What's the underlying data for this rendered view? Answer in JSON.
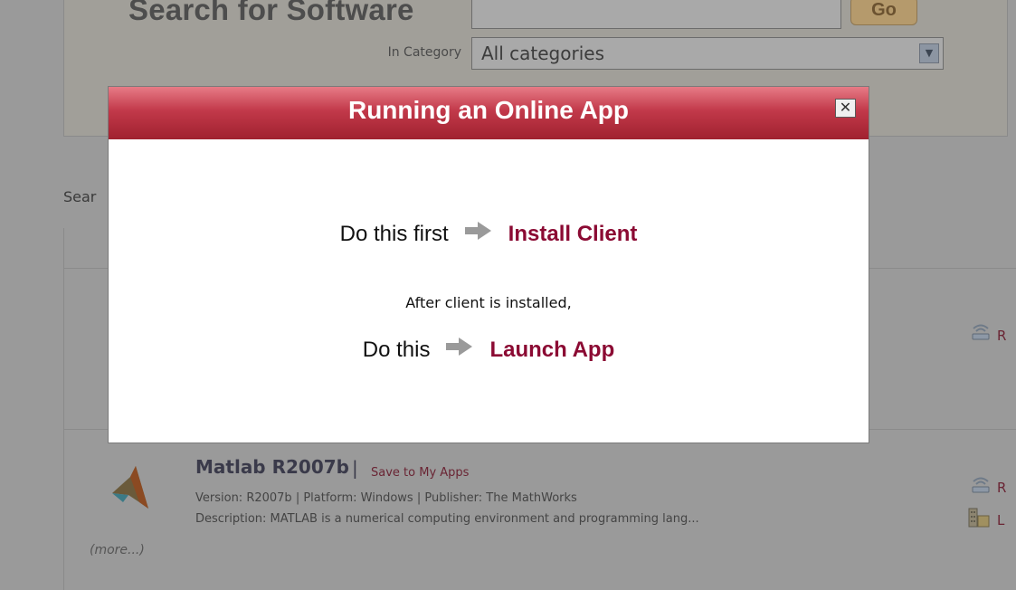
{
  "search": {
    "title": "Search for Software",
    "go_label": "Go",
    "category_label": "In Category",
    "category_value": "All categories"
  },
  "results": {
    "label": "Sear",
    "rows": [
      {
        "right_link": "R"
      },
      {
        "name": "Matlab R2007b",
        "separator": "|",
        "save_link": "Save to My Apps",
        "meta": "Version: R2007b | Platform: Windows | Publisher: The MathWorks",
        "description": "Description: MATLAB is a numerical computing environment and programming lang...",
        "more": "(more...)",
        "run_link": "R",
        "lab_link": "L"
      }
    ]
  },
  "modal": {
    "title": "Running an Online App",
    "close": "✕",
    "step1_label": "Do this first",
    "step1_action": "Install Client",
    "after_text": "After client is installed,",
    "step2_label": "Do this",
    "step2_action": "Launch App"
  },
  "colors": {
    "accent": "#8b0a33",
    "header_top": "#e77b86",
    "header_bottom": "#a0212f",
    "overlay": "#9a9a9a"
  },
  "icons": [
    "close-icon",
    "arrow-right-icon",
    "matlab-logo-icon",
    "remote-run-icon",
    "lab-building-icon",
    "select-arrow-icon"
  ]
}
